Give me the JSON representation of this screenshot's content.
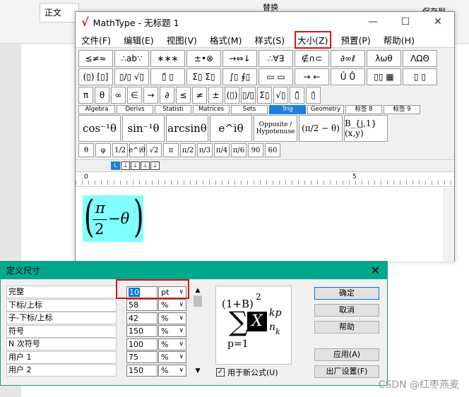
{
  "word": {
    "style_label": "正文",
    "right_labels": [
      "替换",
      "保存到"
    ]
  },
  "mathtype": {
    "title": "MathType - 无标题 1",
    "menu": [
      "文件(F)",
      "编辑(E)",
      "视图(V)",
      "格式(M)",
      "样式(S)",
      "大小(Z)",
      "预置(P)",
      "帮助(H)"
    ],
    "menu_highlighted_index": 5,
    "palette_row1": [
      "≤≠≈",
      "∴ab∵",
      "∗∗∗",
      "±•⊗",
      "→⇔↓",
      "∴∀∃",
      "∉∩⊂",
      "∂∞ℓ",
      "λωθ",
      "ΛΩΘ"
    ],
    "palette_row2": [
      "(▯) [▯]",
      "▯/▯ √▯",
      "▯̄ ▯",
      "Σ▯ Σ▯",
      "∫▯ ∮▯",
      "▭ ▭",
      "→ ←",
      "Ū Ů",
      "▯▯ ▦",
      "▯ ▯"
    ],
    "palette_row3": [
      "π",
      "θ",
      "∞",
      "∈",
      "→",
      "∂",
      "≤",
      "≠",
      "±",
      "(▯)",
      "▯/▯",
      "Σ▯",
      "√▯",
      "▯̄",
      "▯̇"
    ],
    "tabs": [
      "Algebra",
      "Derivs",
      "Statisti",
      "Matrices",
      "Sets",
      "Trig",
      "Geometry",
      "标签 8",
      "标签 9"
    ],
    "active_tab_index": 5,
    "templates": [
      "cos⁻¹θ",
      "sin⁻¹θ",
      "arcsinθ",
      "e^iθ",
      "Opposite / Hypotenuse",
      "(π/2 − θ)",
      "B_{j,1}(x,y)"
    ],
    "small_buttons": [
      "θ",
      "φ",
      "1/2",
      "e^iθ",
      "√2",
      "π",
      "π/2",
      "π/3",
      "π/4",
      "π/6",
      "90",
      "60"
    ],
    "tab_stops": [
      "L",
      "⊥",
      "⊥",
      "⊥",
      "⊥"
    ],
    "ruler_labels": [
      "0",
      "5"
    ],
    "formula": {
      "numerator": "π",
      "denominator": "2",
      "rest": "−θ"
    }
  },
  "dialog": {
    "title": "定义尺寸",
    "close": "✕",
    "rows": [
      {
        "label": "完整",
        "value": "10",
        "unit": "pt"
      },
      {
        "label": "下标/上标",
        "value": "58",
        "unit": "%"
      },
      {
        "label": "子-下标/上标",
        "value": "42",
        "unit": "%"
      },
      {
        "label": "符号",
        "value": "150",
        "unit": "%"
      },
      {
        "label": "N 次符号",
        "value": "100",
        "unit": "%"
      },
      {
        "label": "用户 1",
        "value": "75",
        "unit": "%"
      },
      {
        "label": "用户 2",
        "value": "150",
        "unit": "%"
      }
    ],
    "preview": {
      "numerator": "(1+B)",
      "power": "2",
      "sum_sub": "p=1",
      "x": "X",
      "sup": "kp",
      "sub": "n",
      "subsub": "k"
    },
    "checkbox_label": "用于新公式(U)",
    "buttons": {
      "ok": "确定",
      "cancel": "取消",
      "help": "帮助",
      "apply": "应用(A)",
      "factory": "出厂设置(F)"
    }
  },
  "watermark": "CSDN @红枣燕麦"
}
